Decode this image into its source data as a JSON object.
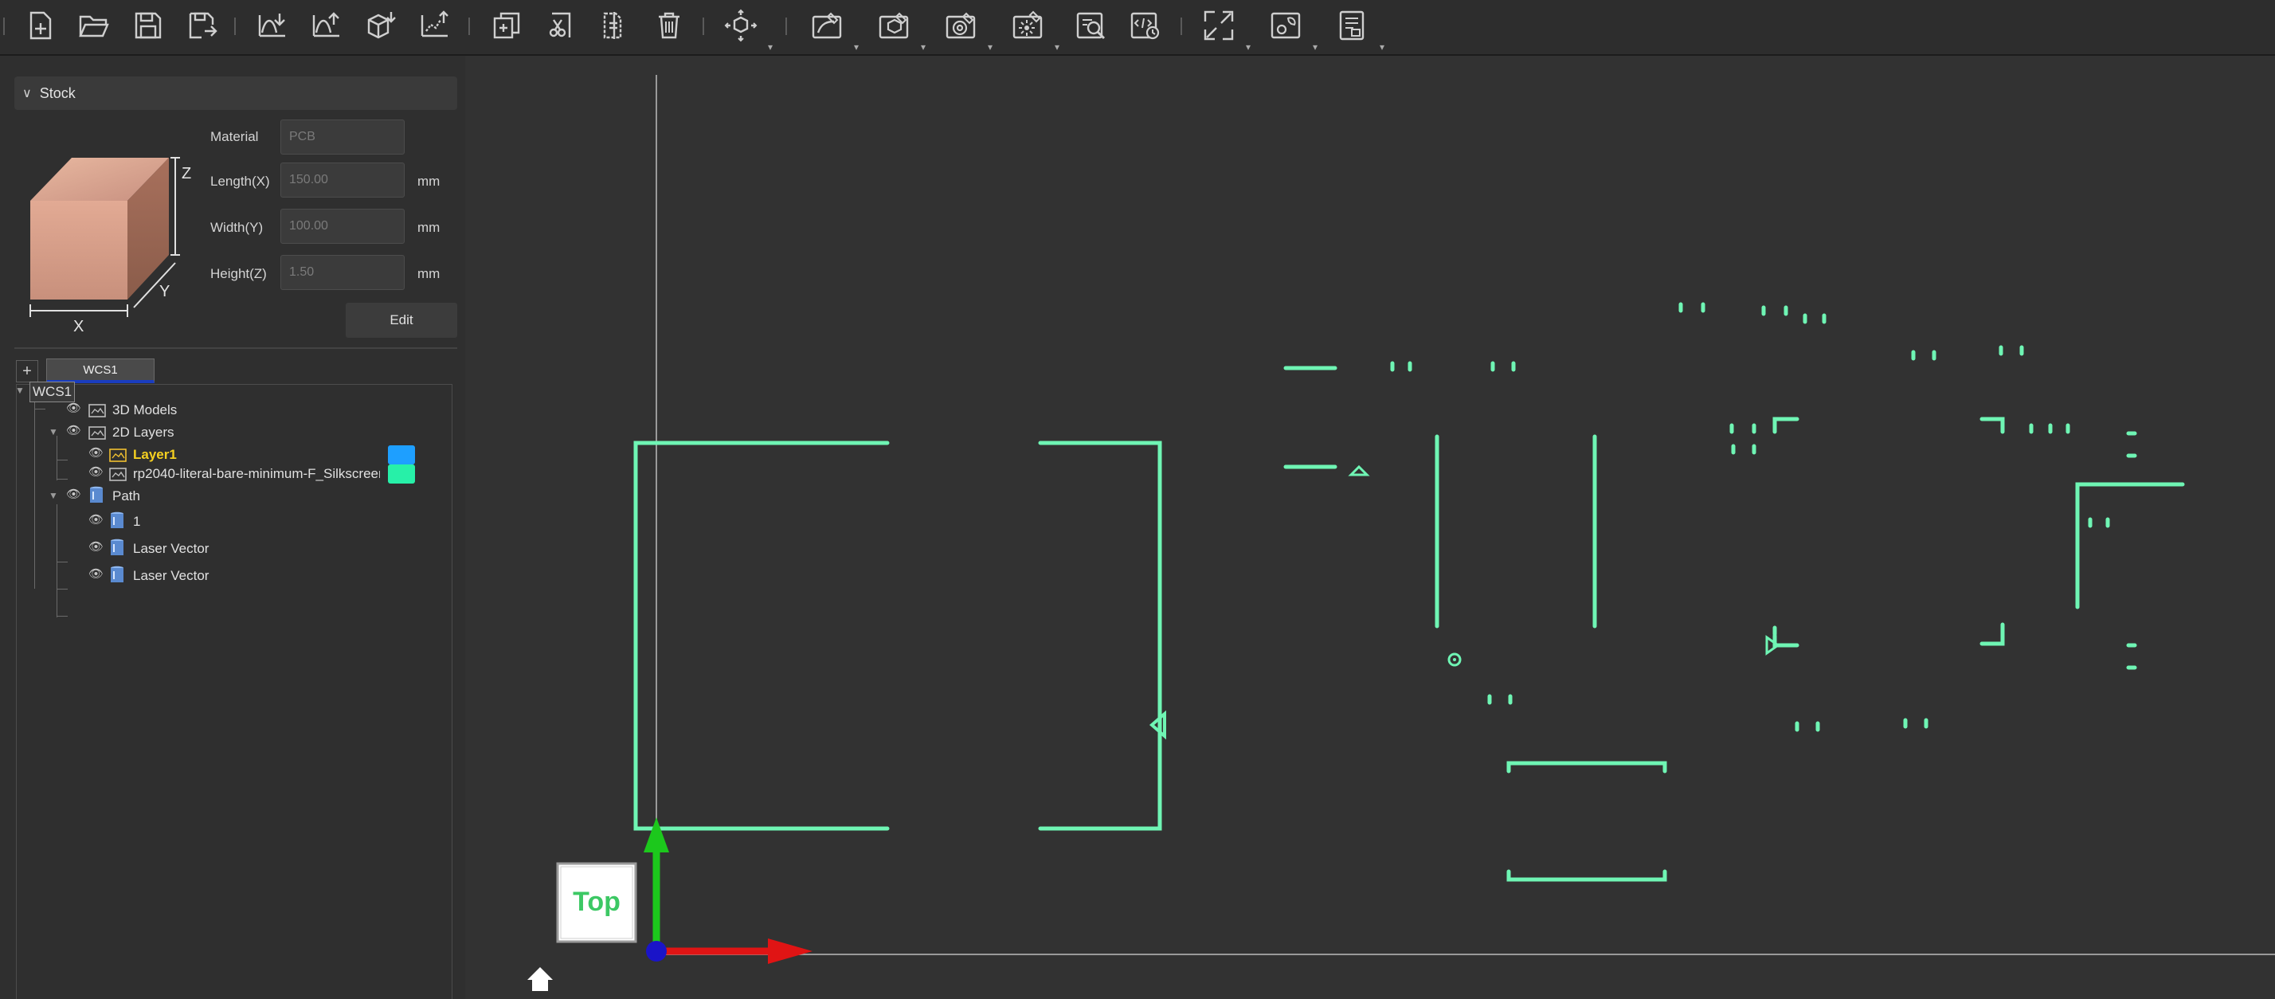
{
  "toolbar": {
    "groups": [
      [
        "new-file-icon",
        "open-folder-icon",
        "save-icon",
        "save-as-icon"
      ],
      [
        "import-curve-icon",
        "export-curve-icon",
        "import-model-icon",
        "export-model-icon"
      ],
      [
        "duplicate-icon",
        "cut-icon",
        "split-icon",
        "delete-icon"
      ],
      [
        "transform-icon"
      ],
      [
        "path-2d-icon",
        "path-3d-icon",
        "rotary-icon",
        "laser-icon",
        "simulate-icon",
        "gcode-icon"
      ],
      [
        "fit-view-icon",
        "view-settings-icon",
        "report-icon"
      ]
    ]
  },
  "stock": {
    "section_title": "Stock",
    "diagram_labels": {
      "z": "Z",
      "y": "Y",
      "x": "X"
    },
    "fields": [
      {
        "label": "Material",
        "value": "PCB",
        "unit": ""
      },
      {
        "label": "Length(X)",
        "value": "150.00",
        "unit": "mm"
      },
      {
        "label": "Width(Y)",
        "value": "100.00",
        "unit": "mm"
      },
      {
        "label": "Height(Z)",
        "value": "1.50",
        "unit": "mm"
      }
    ],
    "edit_label": "Edit"
  },
  "wcs": {
    "add_label": "+",
    "tab_label": "WCS1"
  },
  "tree": {
    "root": "WCS1",
    "models": "3D Models",
    "layers": "2D Layers",
    "layer1": "Layer1",
    "layer2": "rp2040-literal-bare-minimum-F_Silkscreen....",
    "layer1_color": "#1e9fff",
    "layer2_color": "#27f0a8",
    "path": "Path",
    "path_items": [
      "1",
      "Laser Vector",
      "Laser Vector"
    ]
  },
  "viewport": {
    "view_label": "Top",
    "outline_color": "#6ff5b4",
    "axis_colors": {
      "x": "#e01414",
      "y": "#1cc81c",
      "origin": "#1a14c8"
    }
  }
}
